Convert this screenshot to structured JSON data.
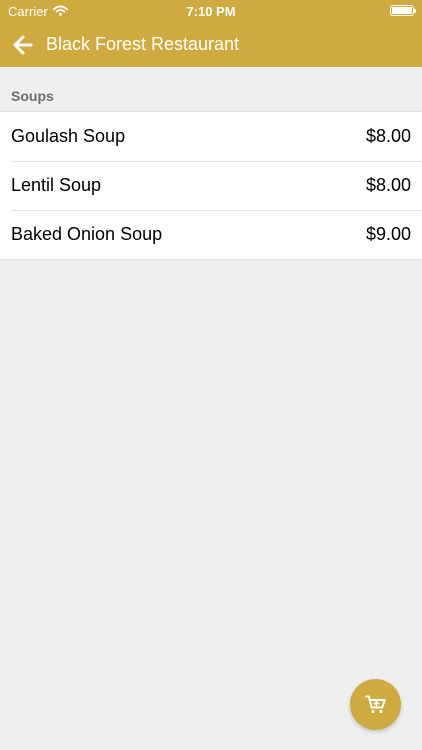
{
  "status_bar": {
    "carrier": "Carrier",
    "time": "7:10 PM"
  },
  "nav": {
    "back_icon": "arrow-left-icon",
    "title": "Black Forest Restaurant"
  },
  "menu": {
    "section_title": "Soups",
    "items": [
      {
        "name": "Goulash Soup",
        "price": "$8.00"
      },
      {
        "name": "Lentil Soup",
        "price": "$8.00"
      },
      {
        "name": "Baked Onion Soup",
        "price": "$9.00"
      }
    ]
  },
  "cart_button": {
    "icon": "shopping-cart-icon"
  },
  "colors": {
    "accent": "#cfaa3f",
    "background": "#efefef"
  }
}
